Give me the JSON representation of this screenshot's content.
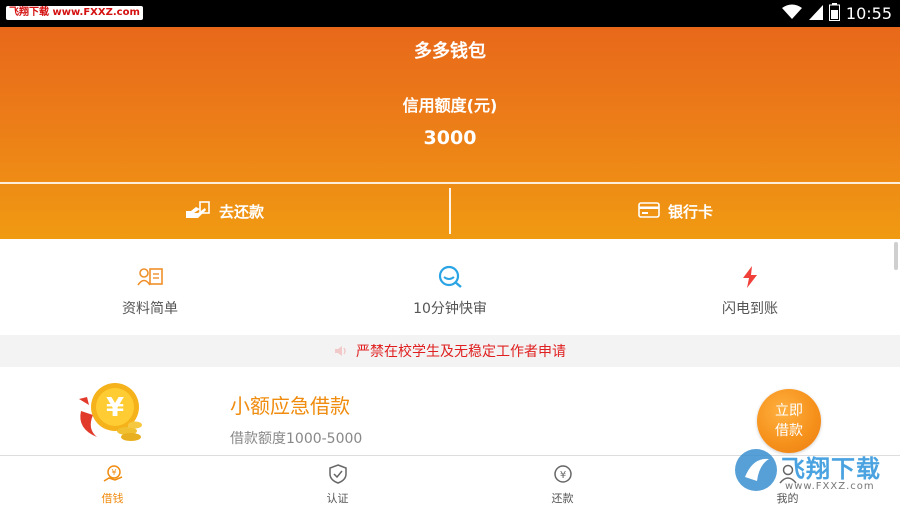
{
  "status_bar": {
    "badge_text": "飞翔下载 www.FXXZ.com",
    "time": "10:55",
    "icons": [
      "wifi-icon",
      "signal-icon",
      "battery-icon"
    ]
  },
  "header": {
    "title": "多多钱包",
    "credit_label": "信用额度(元)",
    "credit_value": "3000",
    "actions": [
      {
        "label": "去还款",
        "icon": "repay-icon"
      },
      {
        "label": "银行卡",
        "icon": "bank-card-icon"
      }
    ]
  },
  "features": [
    {
      "label": "资料简单",
      "icon": "profile-card-icon"
    },
    {
      "label": "10分钟快审",
      "icon": "quick-review-icon"
    },
    {
      "label": "闪电到账",
      "icon": "lightning-icon"
    }
  ],
  "notice": {
    "text": "严禁在校学生及无稳定工作者申请",
    "icon": "speaker-icon"
  },
  "loan": {
    "title": "小额应急借款",
    "range": "借款额度1000-5000",
    "button_label": "立即借款",
    "illustration": "yuan-coin-icon"
  },
  "bottom_nav": [
    {
      "label": "借钱",
      "icon": "borrow-icon",
      "active": true
    },
    {
      "label": "认证",
      "icon": "shield-icon",
      "active": false
    },
    {
      "label": "还款",
      "icon": "repay-icon",
      "active": false
    },
    {
      "label": "我的",
      "icon": "user-icon",
      "active": false
    }
  ],
  "watermark": {
    "text": "飞翔下载",
    "url": "www.FXXZ.com"
  },
  "colors": {
    "primary_orange": "#ec7d18",
    "loan_title": "#f08c10",
    "notice_red": "#e02020",
    "feature_blue": "#2aa4e4",
    "feature_red": "#f0403a"
  }
}
